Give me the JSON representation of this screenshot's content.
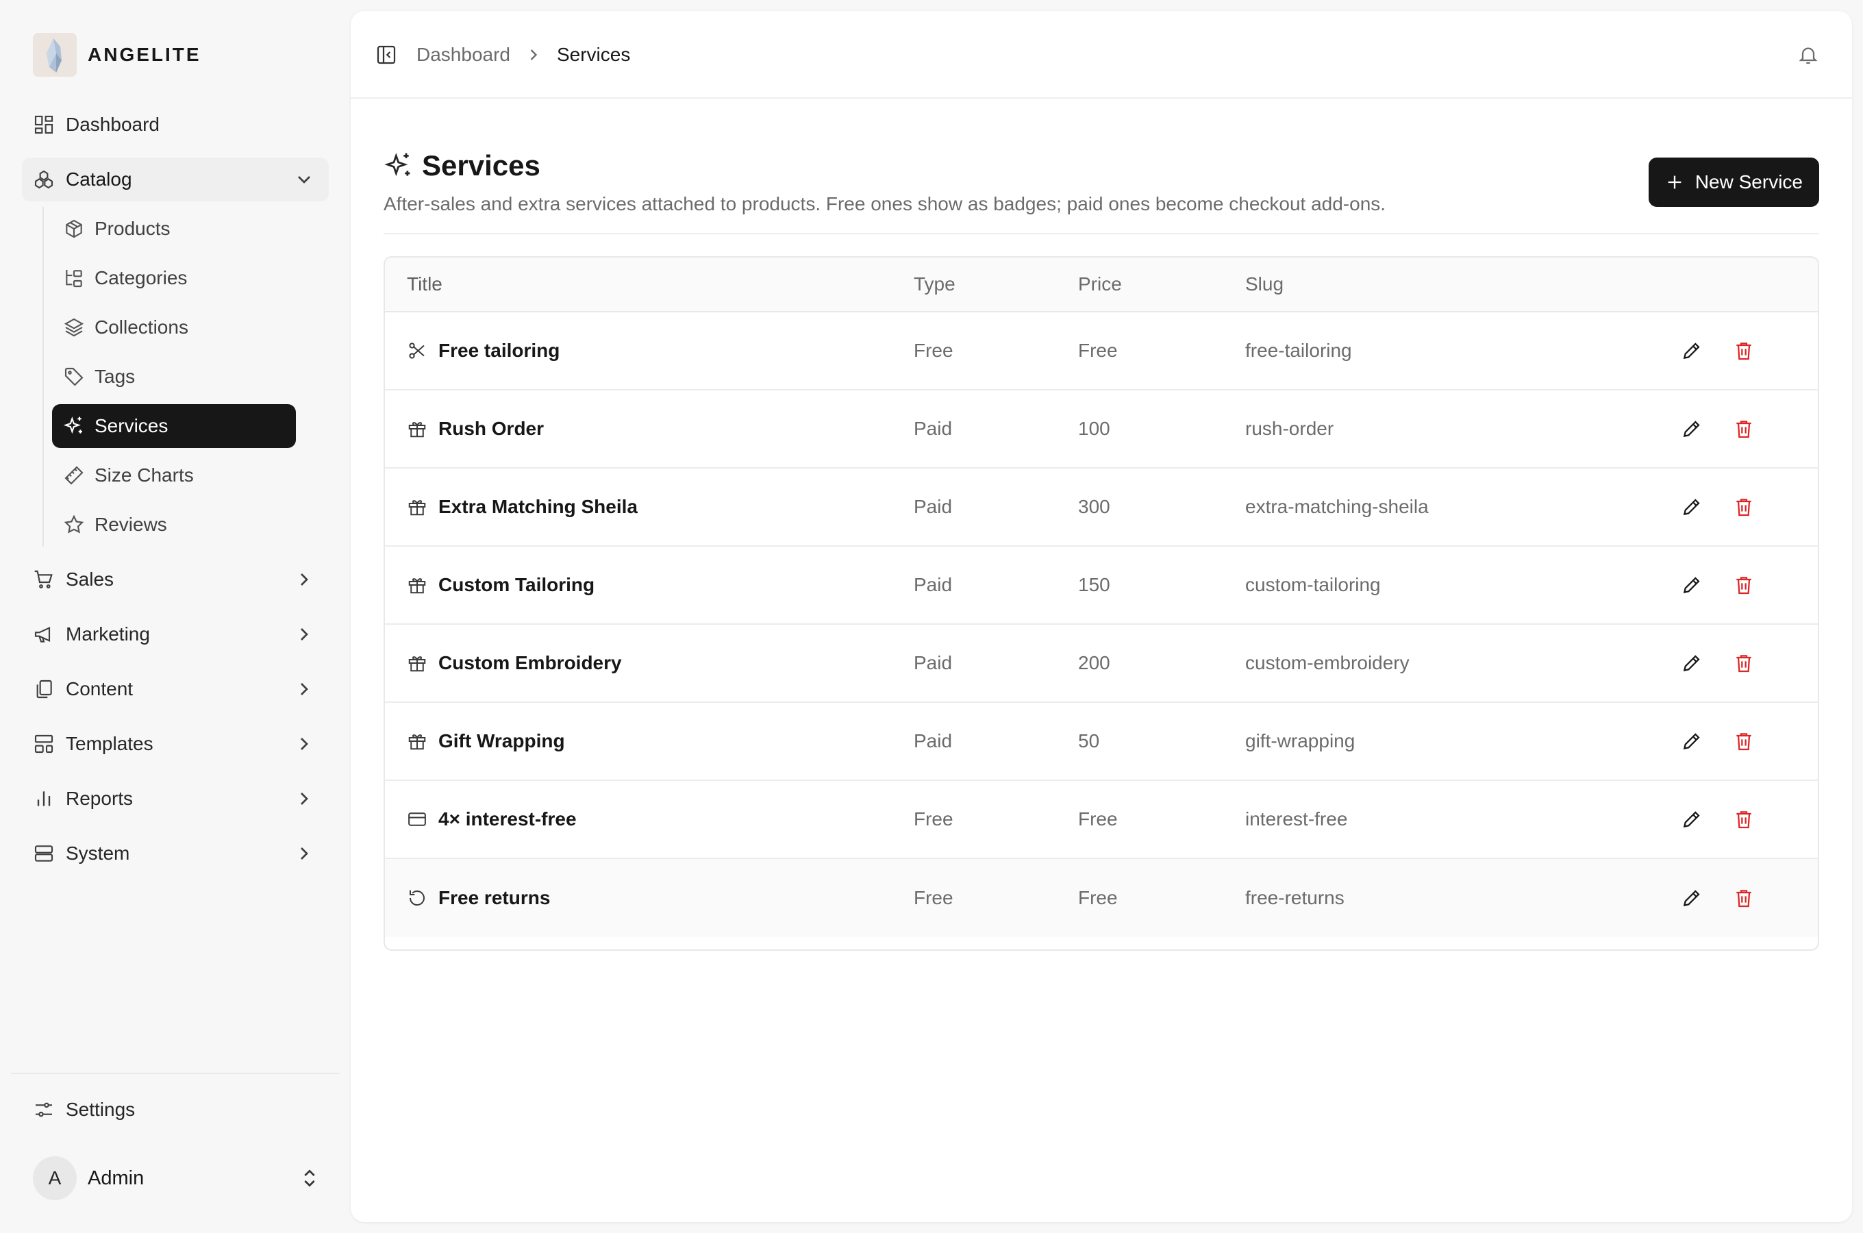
{
  "brand": {
    "name": "ANGELITE"
  },
  "sidebar": {
    "items": [
      {
        "label": "Dashboard",
        "icon": "dashboard-icon"
      },
      {
        "label": "Catalog",
        "icon": "catalog-icon",
        "expanded": true,
        "children": [
          {
            "label": "Products",
            "icon": "box-icon"
          },
          {
            "label": "Categories",
            "icon": "categories-icon"
          },
          {
            "label": "Collections",
            "icon": "layers-icon"
          },
          {
            "label": "Tags",
            "icon": "tag-icon"
          },
          {
            "label": "Services",
            "icon": "sparkles-icon",
            "active": true
          },
          {
            "label": "Size Charts",
            "icon": "ruler-icon"
          },
          {
            "label": "Reviews",
            "icon": "star-icon"
          }
        ]
      },
      {
        "label": "Sales",
        "icon": "cart-icon"
      },
      {
        "label": "Marketing",
        "icon": "megaphone-icon"
      },
      {
        "label": "Content",
        "icon": "copy-icon"
      },
      {
        "label": "Templates",
        "icon": "templates-icon"
      },
      {
        "label": "Reports",
        "icon": "bar-chart-icon"
      },
      {
        "label": "System",
        "icon": "server-icon"
      }
    ],
    "settings_label": "Settings",
    "user": {
      "initial": "A",
      "name": "Admin"
    }
  },
  "breadcrumb": {
    "parent": "Dashboard",
    "current": "Services"
  },
  "page": {
    "title": "Services",
    "description": "After-sales and extra services attached to products. Free ones show as badges; paid ones become checkout add-ons.",
    "new_button_label": "New Service"
  },
  "table": {
    "columns": {
      "title": "Title",
      "type": "Type",
      "price": "Price",
      "slug": "Slug"
    },
    "rows": [
      {
        "title": "Free tailoring",
        "type": "Free",
        "price": "Free",
        "slug": "free-tailoring",
        "icon": "scissors-icon"
      },
      {
        "title": "Rush Order",
        "type": "Paid",
        "price": "100",
        "slug": "rush-order",
        "icon": "gift-icon"
      },
      {
        "title": "Extra Matching Sheila",
        "type": "Paid",
        "price": "300",
        "slug": "extra-matching-sheila",
        "icon": "gift-icon"
      },
      {
        "title": "Custom Tailoring",
        "type": "Paid",
        "price": "150",
        "slug": "custom-tailoring",
        "icon": "gift-icon"
      },
      {
        "title": "Custom Embroidery",
        "type": "Paid",
        "price": "200",
        "slug": "custom-embroidery",
        "icon": "gift-icon"
      },
      {
        "title": "Gift Wrapping",
        "type": "Paid",
        "price": "50",
        "slug": "gift-wrapping",
        "icon": "gift-icon"
      },
      {
        "title": "4× interest-free",
        "type": "Free",
        "price": "Free",
        "slug": "interest-free",
        "icon": "credit-card-icon"
      },
      {
        "title": "Free returns",
        "type": "Free",
        "price": "Free",
        "slug": "free-returns",
        "icon": "rotate-ccw-icon"
      }
    ]
  },
  "colors": {
    "accent": "#171717",
    "danger": "#dc2626",
    "muted_text": "#6b6b6b"
  }
}
